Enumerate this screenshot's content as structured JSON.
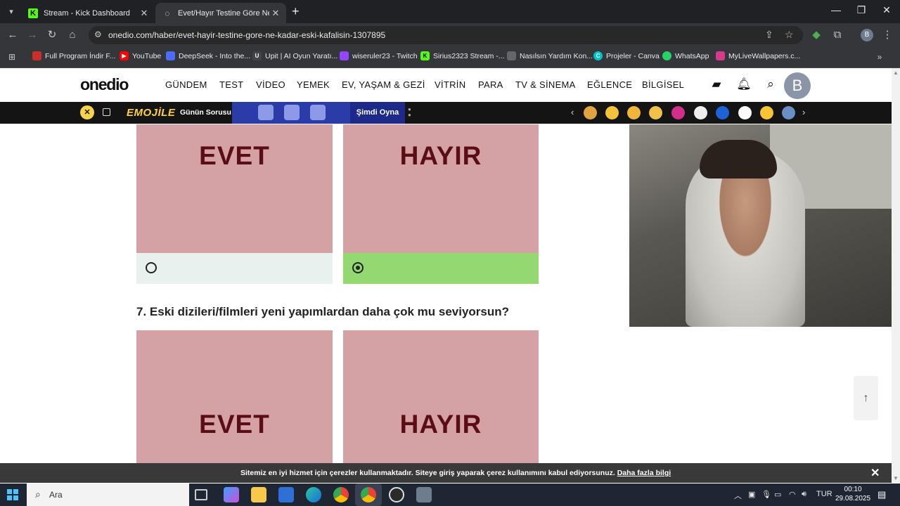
{
  "browser": {
    "tabs": [
      {
        "title": "Stream - Kick Dashboard",
        "favicon": "kick-icon",
        "active": false
      },
      {
        "title": "Evet/Hayır Testine Göre Ne Kad",
        "favicon": "onedio-icon",
        "active": true
      }
    ],
    "url": "onedio.com/haber/evet-hayir-testine-gore-ne-kadar-eski-kafalisin-1307895",
    "profile_initial": "B",
    "bookmarks": [
      {
        "label": "Full Program İndir F...",
        "color": "#c9302c"
      },
      {
        "label": "YouTube",
        "color": "#ff0000"
      },
      {
        "label": "DeepSeek - Into the...",
        "color": "#4d6bfe"
      },
      {
        "label": "Upit | AI Oyun Yaratı...",
        "color": "#444444"
      },
      {
        "label": "wiseruler23 - Twitch",
        "color": "#9146ff"
      },
      {
        "label": "Sirius2323 Stream -...",
        "color": "#53fc18"
      },
      {
        "label": "Nasılsın Yardım Kon...",
        "color": "#666666"
      },
      {
        "label": "Projeler - Canva",
        "color": "#00c4cc"
      },
      {
        "label": "WhatsApp",
        "color": "#25d366"
      },
      {
        "label": "MyLiveWallpapers.c...",
        "color": "#d63a8a"
      }
    ]
  },
  "site": {
    "logo": "onedio",
    "nav": [
      "GÜNDEM",
      "TEST",
      "VİDEO",
      "YEMEK",
      "EV, YAŞAM & GEZİ",
      "VİTRİN",
      "PARA",
      "TV & SİNEMA",
      "EĞLENCE",
      "BİLGİSEL"
    ],
    "avatar_initial": "B",
    "promo": {
      "brand": "EMOJİLE",
      "daily": "Günün Sorusu",
      "play": "Şimdi Oyna"
    }
  },
  "quiz": {
    "prev_options": [
      {
        "label": "EVET",
        "selected": false
      },
      {
        "label": "HAYIR",
        "selected": true
      }
    ],
    "question": "7. Eski dizileri/filmleri yeni yapımlardan daha çok mu seviyorsun?",
    "options": [
      {
        "label": "EVET"
      },
      {
        "label": "HAYIR"
      }
    ]
  },
  "cookie": {
    "text": "Sitemiz en iyi hizmet için çerezler kullanmaktadır. Siteye giriş yaparak çerez kullanımını kabul ediyorsunuz.",
    "link": "Daha fazla bilgi"
  },
  "taskbar": {
    "search_placeholder": "Ara",
    "language": "TUR",
    "time": "00:10",
    "date": "29.08.2025"
  },
  "colors": {
    "card": "#d4a1a5",
    "card_text": "#5a0d14",
    "selected_option": "#94d872",
    "unselected_option": "#e9f1ee"
  }
}
